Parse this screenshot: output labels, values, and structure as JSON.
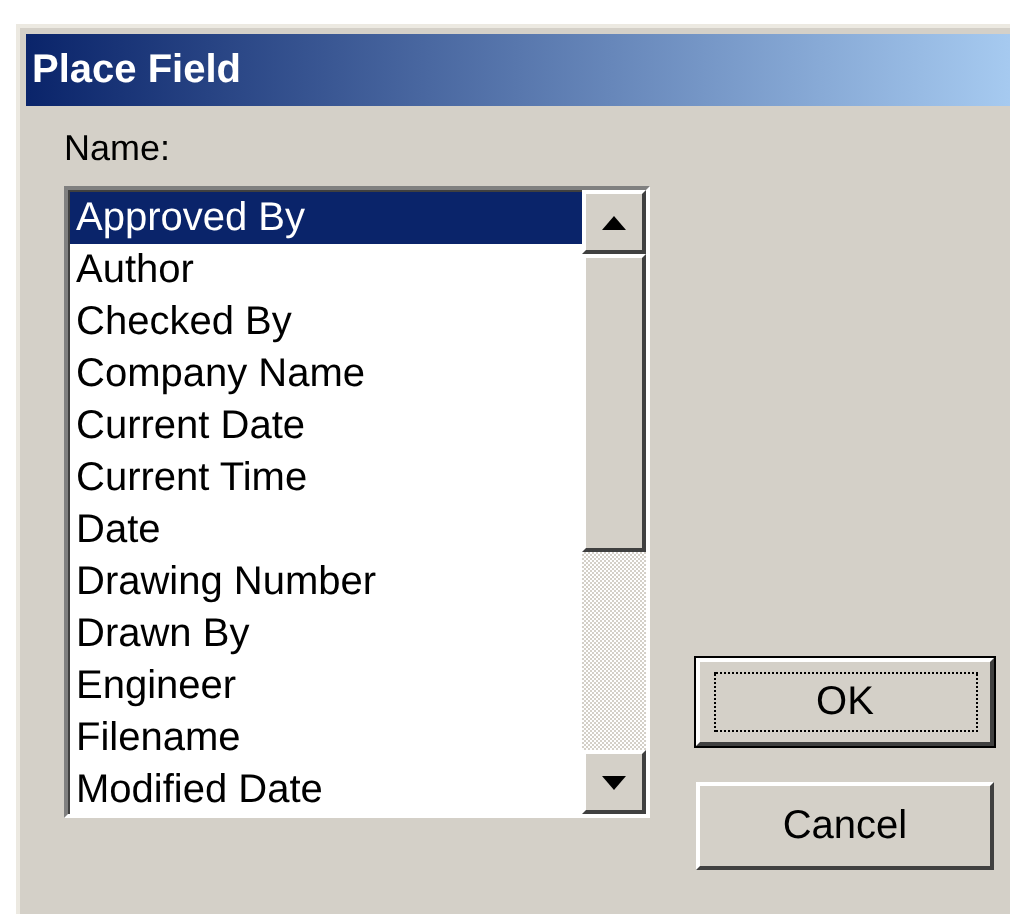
{
  "window": {
    "title": "Place Field"
  },
  "name_label": "Name:",
  "list": [
    {
      "label": "Approved By",
      "selected": true
    },
    {
      "label": "Author",
      "selected": false
    },
    {
      "label": "Checked By",
      "selected": false
    },
    {
      "label": "Company Name",
      "selected": false
    },
    {
      "label": "Current Date",
      "selected": false
    },
    {
      "label": "Current Time",
      "selected": false
    },
    {
      "label": "Date",
      "selected": false
    },
    {
      "label": "Drawing Number",
      "selected": false
    },
    {
      "label": "Drawn By",
      "selected": false
    },
    {
      "label": "Engineer",
      "selected": false
    },
    {
      "label": "Filename",
      "selected": false
    },
    {
      "label": "Modified Date",
      "selected": false
    }
  ],
  "buttons": [
    {
      "label": "OK",
      "default": true
    },
    {
      "label": "Cancel",
      "default": false
    }
  ]
}
